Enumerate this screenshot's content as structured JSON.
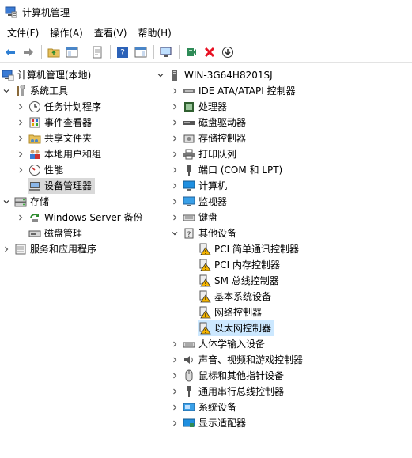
{
  "window": {
    "title": "计算机管理"
  },
  "menu": [
    {
      "id": "file",
      "label": "文件(F)"
    },
    {
      "id": "action",
      "label": "操作(A)"
    },
    {
      "id": "view",
      "label": "查看(V)"
    },
    {
      "id": "help",
      "label": "帮助(H)"
    }
  ],
  "left_tree": {
    "root": "计算机管理(本地)",
    "system_tools": "系统工具",
    "task_scheduler": "任务计划程序",
    "event_viewer": "事件查看器",
    "shared_folders": "共享文件夹",
    "local_users": "本地用户和组",
    "performance": "性能",
    "device_manager": "设备管理器",
    "storage": "存储",
    "windows_server_backup": "Windows Server 备份",
    "disk_management": "磁盘管理",
    "services_apps": "服务和应用程序"
  },
  "right_tree": {
    "computer_name": "WIN-3G64H8201SJ",
    "categories": [
      "IDE ATA/ATAPI 控制器",
      "处理器",
      "磁盘驱动器",
      "存储控制器",
      "打印队列",
      "端口 (COM 和 LPT)",
      "计算机",
      "监视器",
      "键盘",
      "其他设备"
    ],
    "other_devices": [
      "PCI 简单通讯控制器",
      "PCI 内存控制器",
      "SM 总线控制器",
      "基本系统设备",
      "网络控制器",
      "以太网控制器"
    ],
    "more_categories": [
      "人体学输入设备",
      "声音、视频和游戏控制器",
      "鼠标和其他指针设备",
      "通用串行总线控制器",
      "系统设备",
      "显示适配器"
    ]
  },
  "colors": {
    "selection": "#cce8ff",
    "selection_gray": "#d9d9d9",
    "warning": "#f5b400",
    "delete": "#e81123"
  }
}
